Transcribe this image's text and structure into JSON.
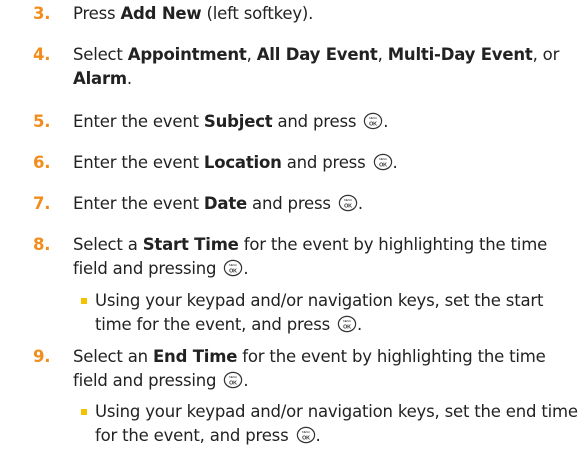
{
  "steps": [
    {
      "num": "3.",
      "parts": [
        {
          "t": "Press "
        },
        {
          "t": "Add New",
          "b": true
        },
        {
          "t": " (left softkey)."
        }
      ]
    },
    {
      "num": "4.",
      "parts": [
        {
          "t": "Select "
        },
        {
          "t": "Appointment",
          "b": true
        },
        {
          "t": ", "
        },
        {
          "t": "All Day Event",
          "b": true
        },
        {
          "t": ", "
        },
        {
          "t": "Multi-Day Event",
          "b": true
        },
        {
          "t": ", or "
        },
        {
          "t": "Alarm",
          "b": true
        },
        {
          "t": "."
        }
      ]
    },
    {
      "num": "5.",
      "parts": [
        {
          "t": "Enter the event "
        },
        {
          "t": "Subject",
          "b": true
        },
        {
          "t": " and press "
        },
        {
          "icon": "menu-ok-key-icon"
        },
        {
          "t": "."
        }
      ]
    },
    {
      "num": "6.",
      "parts": [
        {
          "t": "Enter the event "
        },
        {
          "t": "Location",
          "b": true
        },
        {
          "t": " and press "
        },
        {
          "icon": "menu-ok-key-icon"
        },
        {
          "t": "."
        }
      ]
    },
    {
      "num": "7.",
      "parts": [
        {
          "t": "Enter the event "
        },
        {
          "t": "Date",
          "b": true
        },
        {
          "t": " and press "
        },
        {
          "icon": "menu-ok-key-icon"
        },
        {
          "t": "."
        }
      ]
    },
    {
      "num": "8.",
      "parts": [
        {
          "t": "Select a "
        },
        {
          "t": "Start Time",
          "b": true
        },
        {
          "t": " for the event by highlighting the time field and pressing "
        },
        {
          "icon": "menu-ok-key-icon"
        },
        {
          "t": "."
        }
      ]
    },
    {
      "bullet": true,
      "parts": [
        {
          "t": "Using your keypad and/or navigation keys, set the start time for the event, and press "
        },
        {
          "icon": "menu-ok-key-icon"
        },
        {
          "t": "."
        }
      ]
    },
    {
      "num": "9.",
      "parts": [
        {
          "t": "Select an "
        },
        {
          "t": "End Time",
          "b": true
        },
        {
          "t": " for the event by highlighting the time field and pressing "
        },
        {
          "icon": "menu-ok-key-icon"
        },
        {
          "t": "."
        }
      ]
    },
    {
      "bullet": true,
      "parts": [
        {
          "t": "Using your keypad and/or navigation keys, set the end time for the event, and press "
        },
        {
          "icon": "menu-ok-key-icon"
        },
        {
          "t": "."
        }
      ]
    }
  ],
  "key_icon": {
    "top_label": "MENU",
    "bottom_label": "OK"
  },
  "colors": {
    "number": "#f28c1b",
    "bullet": "#f3c300",
    "text": "#222222"
  }
}
